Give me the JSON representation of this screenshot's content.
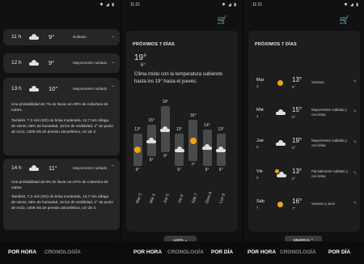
{
  "status": {
    "time": "11:21",
    "icons": "✱ ◢ ▮"
  },
  "panel1": {
    "rows": [
      {
        "hour": "11 h",
        "temp": "9°",
        "desc": "Nublado",
        "chevron": "⌄"
      },
      {
        "hour": "12 h",
        "temp": "9°",
        "desc": "Mayormente nublado",
        "chevron": "⌄"
      },
      {
        "hour": "13 h",
        "temp": "10°",
        "desc": "Mayormente nublado",
        "chevron": "⌃",
        "detail1": "Una probabilidad de 7% de lluvia con 89% de cobertura de nubes.",
        "detail2": "También: 7,3 m/s (SO) de brisa moderada, 12,7 m/s ráfaga de viento, 55% de humedad, 16 km de visibilidad, 2° de punto de rocío, 1009 mb de presión atmosférica, UV de 3."
      },
      {
        "hour": "14 h",
        "temp": "11°",
        "desc": "Mayormente nublado",
        "chevron": "⌃",
        "detail1": "Una probabilidad de 8% de lluvia con 87% de cobertura de nubes.",
        "detail2": "También: 7,3 m/s (SO) de brisa moderada, 13,7 m/s ráfaga de viento, 55% de humedad, 16 km de visibilidad, 2° de punto de rocío, 1008 mb de presión atmosférica, UV de 3."
      }
    ],
    "nav": {
      "tab1": "POR HORA",
      "tab2": "CRONOLOGÍA"
    }
  },
  "panel2": {
    "title": "PRÓXIMOS 7 DÍAS",
    "hi": "19°",
    "lo": "6°",
    "summary": "Clima mixto con la temperatura subiendo hasta los 19° hacia el jueves.",
    "pill": "LISTA ⌄",
    "nav": {
      "tab1": "POR HORA",
      "tab2": "CRONOLOGÍA",
      "tab3": "POR DÍA"
    }
  },
  "chart_data": {
    "type": "bar",
    "categories": [
      "Mar 3",
      "Mié 4",
      "Jue 5",
      "Vie 6",
      "Sáb 7",
      "Dom 8",
      "Lun 9"
    ],
    "series": [
      {
        "values": [
          13,
          15,
          19,
          13,
          16,
          14,
          13
        ]
      },
      {
        "values": [
          6,
          8,
          9,
          6,
          7,
          6,
          6
        ]
      }
    ],
    "high_labels": [
      "13°",
      "15°",
      "19°",
      "13°",
      "16°",
      "14°",
      "13°"
    ],
    "low_labels": [
      "6°",
      "8°",
      "9°",
      "6°",
      "7°",
      "6°",
      "6°"
    ],
    "icons": [
      "sun",
      "cloud",
      "cloud",
      "cloud",
      "sun",
      "cloud",
      "cloud"
    ],
    "ylim": [
      4,
      21
    ]
  },
  "panel3": {
    "title": "PRÓXIMOS 7 DÍAS",
    "days": [
      {
        "name": "Mar",
        "date": "3",
        "hi": "13°",
        "lo": "6°",
        "desc": "Ventoso",
        "icon": "sun"
      },
      {
        "name": "Mié",
        "date": "4",
        "hi": "15°",
        "lo": "8°",
        "desc": "Mayormente nublado y con brisa",
        "icon": "cloud"
      },
      {
        "name": "Jue",
        "date": "5",
        "hi": "19°",
        "lo": "9°",
        "desc": "Mayormente nublado y con brisa",
        "icon": "cloud"
      },
      {
        "name": "Vie",
        "date": "6",
        "hi": "13°",
        "lo": "6°",
        "desc": "Parcialmente nublado y con brisa",
        "icon": "partly"
      },
      {
        "name": "Sáb",
        "date": "7",
        "hi": "16°",
        "lo": "7°",
        "desc": "Ventoso y seco",
        "icon": "sun"
      }
    ],
    "pill": "GRÁFICA ⌃",
    "nav": {
      "tab1": "POR HORA",
      "tab2": "CRONOLOGÍA",
      "tab3": "POR DÍA"
    }
  },
  "colors": {
    "sun": "#f0a800",
    "card": "#1d1d1d",
    "bar": "#4a4a4a"
  }
}
